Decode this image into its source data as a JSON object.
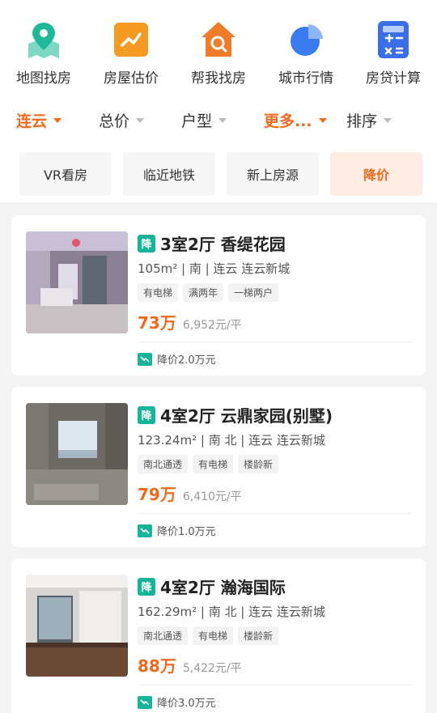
{
  "quick_entries": [
    {
      "label": "地图找房",
      "icon": "map-location-icon",
      "color": "#20b89a"
    },
    {
      "label": "房屋估价",
      "icon": "trend-chart-icon",
      "color": "#f59a23"
    },
    {
      "label": "帮我找房",
      "icon": "house-search-icon",
      "color": "#f07c2a"
    },
    {
      "label": "城市行情",
      "icon": "pie-chart-icon",
      "color": "#3b7bf0"
    },
    {
      "label": "房贷计算",
      "icon": "calculator-icon",
      "color": "#3b6fe8"
    }
  ],
  "filters": [
    {
      "label": "连云",
      "active": true
    },
    {
      "label": "总价",
      "active": false
    },
    {
      "label": "户型",
      "active": false
    },
    {
      "label": "更多...",
      "active": true
    },
    {
      "label": "排序",
      "active": false
    }
  ],
  "quick_tags": [
    {
      "label": "VR看房",
      "active": false
    },
    {
      "label": "临近地铁",
      "active": false
    },
    {
      "label": "新上房源",
      "active": false
    },
    {
      "label": "降价",
      "active": true
    }
  ],
  "listings": [
    {
      "badge": "降",
      "title": "3室2厅 香缇花园",
      "meta": "105m² | 南 | 连云 连云新城",
      "tags": [
        "有电梯",
        "满两年",
        "一梯两户"
      ],
      "total_price": "73万",
      "unit_price": "6,952元/平",
      "price_drop": "降价2.0万元"
    },
    {
      "badge": "降",
      "title": "4室2厅 云鼎家园(别墅)",
      "meta": "123.24m² | 南 北 | 连云 连云新城",
      "tags": [
        "南北通透",
        "有电梯",
        "楼龄新"
      ],
      "total_price": "79万",
      "unit_price": "6,410元/平",
      "price_drop": "降价1.0万元"
    },
    {
      "badge": "降",
      "title": "4室2厅 瀚海国际",
      "meta": "162.29m² | 南 北 | 连云 连云新城",
      "tags": [
        "南北通透",
        "有电梯",
        "楼龄新"
      ],
      "total_price": "88万",
      "unit_price": "5,422元/平",
      "price_drop": "降价3.0万元"
    }
  ],
  "accent_color": "#f06a1d",
  "badge_color": "#18b49a"
}
